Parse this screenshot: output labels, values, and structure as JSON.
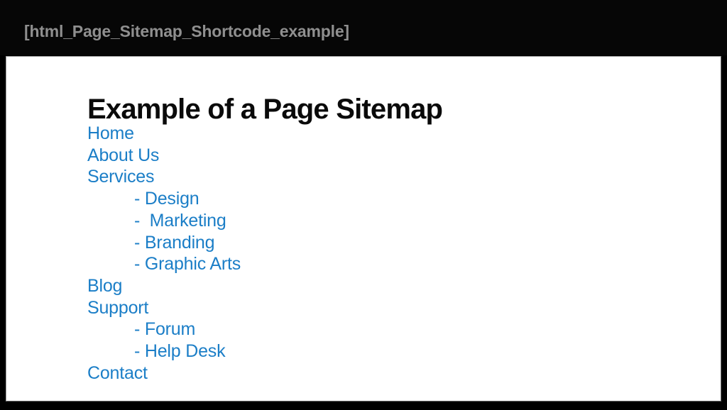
{
  "header": {
    "shortcode_label": "[html_Page_Sitemap_Shortcode_example]",
    "background_color": "#060606",
    "text_color": "#8f8f8f"
  },
  "document": {
    "title": "Example of a Page Sitemap",
    "title_color": "#0a0a0a",
    "background_color": "#ffffff",
    "link_color": "#1b7ec7"
  },
  "sitemap": {
    "items": [
      {
        "label": "Home",
        "level": 1
      },
      {
        "label": "About Us",
        "level": 1
      },
      {
        "label": "Services",
        "level": 1
      },
      {
        "label": "- Design",
        "level": 2
      },
      {
        "label": "-  Marketing",
        "level": 2
      },
      {
        "label": "- Branding",
        "level": 2
      },
      {
        "label": "- Graphic Arts",
        "level": 2
      },
      {
        "label": "Blog",
        "level": 1
      },
      {
        "label": "Support",
        "level": 1
      },
      {
        "label": "- Forum",
        "level": 2
      },
      {
        "label": "- Help Desk",
        "level": 2
      },
      {
        "label": "Contact",
        "level": 1
      }
    ]
  }
}
